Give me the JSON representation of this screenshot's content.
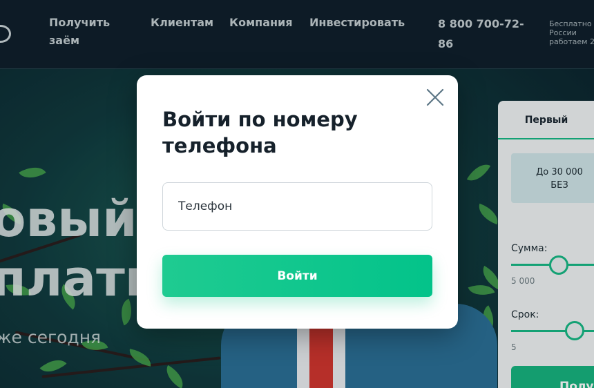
{
  "header": {
    "nav": {
      "get_loan": "Получить заём",
      "clients": "Клиентам",
      "company": "Компания",
      "invest": "Инвестировать"
    },
    "phone": "8 800 700-72-86",
    "free_note_line1": "Бесплатно",
    "free_note_line2": "России",
    "free_note_line3": "работаем 2"
  },
  "hero": {
    "title_line1": "овый з",
    "title_line2": "платн",
    "subtitle": "же сегодня"
  },
  "calculator": {
    "tab_first": "Первый",
    "promo_line1": "До 30 000",
    "promo_line2": "БЕЗ",
    "sum_label": "Сумма:",
    "sum_min": "5 000",
    "term_label": "Срок:",
    "term_min": "5",
    "submit_label": "Полу"
  },
  "modal": {
    "title": "Войти по номеру телефона",
    "phone_placeholder": "Телефон",
    "login_button": "Войти"
  },
  "colors": {
    "accent": "#0fc48a",
    "modal_bg": "#ffffff",
    "title_text": "#16212b",
    "header_bg": "#0f1f2c"
  },
  "icons": {
    "close": "close-icon"
  }
}
